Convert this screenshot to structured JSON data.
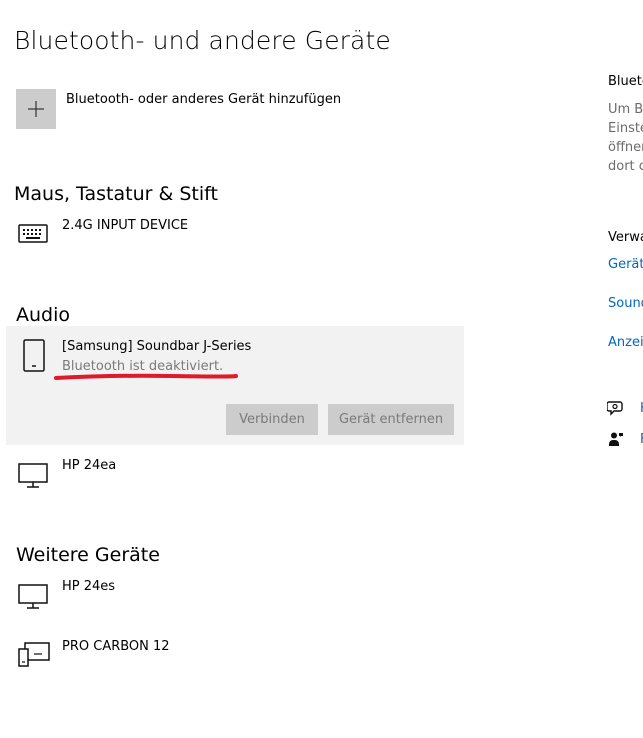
{
  "page": {
    "title": "Bluetooth- und andere Geräte"
  },
  "add_device": {
    "label": "Bluetooth- oder anderes Gerät hinzufügen"
  },
  "sections": {
    "mouse": {
      "heading": "Maus, Tastatur & Stift",
      "devices": [
        {
          "name": "2.4G INPUT DEVICE",
          "icon": "keyboard-icon"
        }
      ]
    },
    "audio": {
      "heading": "Audio",
      "selected_device": {
        "name": "[Samsung] Soundbar J-Series",
        "status": "Bluetooth ist deaktiviert.",
        "icon": "phone-device-icon",
        "connect_label": "Verbinden",
        "remove_label": "Gerät entfernen"
      },
      "devices": [
        {
          "name": "HP 24ea",
          "icon": "monitor-icon"
        }
      ]
    },
    "other": {
      "heading": "Weitere Geräte",
      "devices": [
        {
          "name": "HP 24es",
          "icon": "monitor-icon"
        },
        {
          "name": "PRO CARBON 12",
          "icon": "pc-monitor-icon"
        }
      ]
    }
  },
  "sidebar": {
    "heading1": "Blueto",
    "description": [
      "Um Bl",
      "Einste",
      "öffner",
      "dort c"
    ],
    "heading2": "Verwa",
    "links": [
      "Geräte",
      "Sound",
      "Anzeig"
    ],
    "help_items": [
      {
        "icon": "help-chat-icon",
        "label": "H"
      },
      {
        "icon": "feedback-person-icon",
        "label": "F"
      }
    ]
  },
  "colors": {
    "accent_link": "#0067c0",
    "annotation_underline": "#e0192b",
    "button_bg": "#cccccc",
    "selected_bg": "#f2f2f2"
  }
}
